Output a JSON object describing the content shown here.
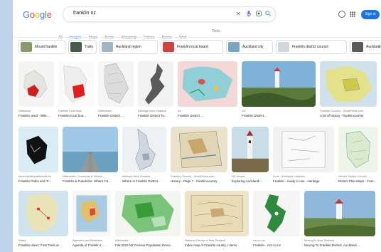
{
  "logo": {
    "text": "Google"
  },
  "search": {
    "query": "franklin nz"
  },
  "header": {
    "signin_label": "Sign in"
  },
  "nav": {
    "items": [
      "All",
      "Images",
      "Maps",
      "News",
      "Shopping",
      "Videos",
      "Books",
      "Web"
    ],
    "tools": "Tools"
  },
  "chips": [
    {
      "label": "Mount franklin",
      "color": "#8a9a6a"
    },
    {
      "label": "Trails",
      "color": "#4a5a4a"
    },
    {
      "label": "Auckland region",
      "color": "#9fb6c9"
    },
    {
      "label": "Franklin local board",
      "color": "#d24040"
    },
    {
      "label": "Auckland city",
      "color": "#7aa4c4"
    },
    {
      "label": "Franklin district council",
      "color": "#cfd6dc"
    },
    {
      "label": "Auckland council",
      "color": "#5a5a5a"
    },
    {
      "label": "Franklin ward",
      "color": "#b7c7a4"
    }
  ],
  "results": [
    {
      "source": "Wikipedia",
      "title": "Franklin ward - Wiki..."
    },
    {
      "source": "Franklin local boar...",
      "title": "Franklin local boa..."
    },
    {
      "source": "Wikimedia",
      "title": "Franklin District ..."
    },
    {
      "source": "Heritage New Zealand",
      "title": "Franklin District To..."
    },
    {
      "source": "Art",
      "title": "Franklin District ..."
    },
    {
      "source": "Art",
      "title": "Franklin District ..."
    },
    {
      "source": "Franklin Country - WordPress.com",
      "title": "A bit of history - franklincountry"
    },
    {
      "source": "www.franklinpathstrails.nz",
      "title": "Franklin Paths and Tr..."
    },
    {
      "source": "Wikimedia, Commons & District...",
      "title": "Franklin & Pukekohe: Where Cit..."
    },
    {
      "source": "Network New Zealand",
      "title": "Where is Franklin District..."
    },
    {
      "source": "Franklin Country - WordPress.com",
      "title": "History - Page 7 - franklincountry"
    },
    {
      "source": "NZ Herald",
      "title": "Exploring Auckland'..."
    },
    {
      "source": "Kura - Auckland Libraries",
      "title": "Franklin - ready in use - Heritage"
    },
    {
      "source": "Herald District Council",
      "title": "District Plan Maps - Fran..."
    },
    {
      "source": "Waka",
      "title": "Franklin Hikes: First Trails ar..."
    },
    {
      "source": "Agencies and Ministries",
      "title": "Agenda of Franklin L..."
    },
    {
      "source": "Wikimedia",
      "title": "File:2022 NZ Census Population Densi..."
    },
    {
      "source": "National Library of New Zealand",
      "title": "Index map of Franklin county, I items..."
    },
    {
      "source": "nzs.co.nz",
      "title": "Franklin - nzs.co.nz"
    },
    {
      "source": "Moving to New Zealand",
      "title": "Moving To Franklin District, Auckland ..."
    }
  ]
}
